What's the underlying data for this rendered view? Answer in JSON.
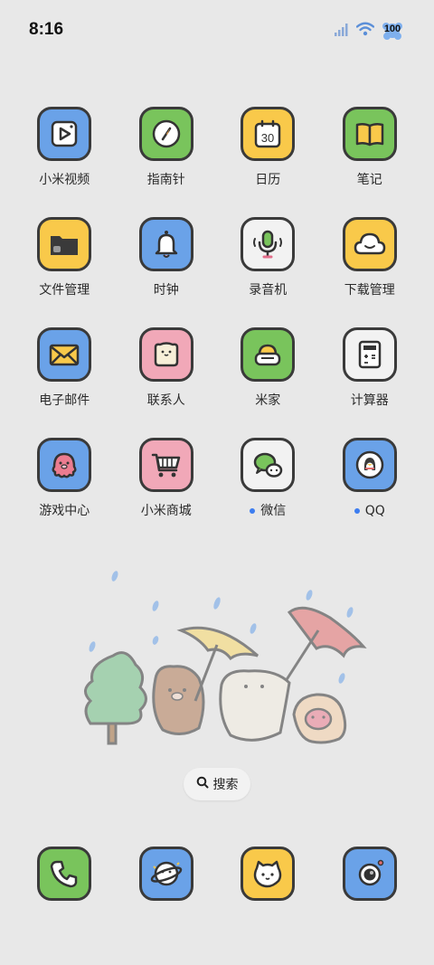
{
  "status_bar": {
    "time": "8:16",
    "battery_level": "100",
    "icons": [
      "signal-icon",
      "wifi-icon",
      "battery-icon"
    ]
  },
  "colors": {
    "background": "#e8e8e8",
    "blue": "#6aa2e8",
    "green": "#79c45c",
    "yellow": "#f9c94a",
    "pink": "#f1a8b8",
    "white": "#f2f2f2",
    "dot": "#3d7df0"
  },
  "apps": [
    {
      "label": "小米视频",
      "icon": "video-play-icon",
      "color": "blue"
    },
    {
      "label": "指南针",
      "icon": "compass-icon",
      "color": "green"
    },
    {
      "label": "日历",
      "icon": "calendar-icon",
      "color": "yellow",
      "day": "30"
    },
    {
      "label": "笔记",
      "icon": "notebook-icon",
      "color": "green"
    },
    {
      "label": "文件管理",
      "icon": "folder-icon",
      "color": "yellow"
    },
    {
      "label": "时钟",
      "icon": "bell-icon",
      "color": "blue"
    },
    {
      "label": "录音机",
      "icon": "microphone-icon",
      "color": "white"
    },
    {
      "label": "下载管理",
      "icon": "cloud-icon",
      "color": "yellow"
    },
    {
      "label": "电子邮件",
      "icon": "envelope-icon",
      "color": "blue"
    },
    {
      "label": "联系人",
      "icon": "contact-card-icon",
      "color": "pink"
    },
    {
      "label": "米家",
      "icon": "home-sofa-icon",
      "color": "green"
    },
    {
      "label": "计算器",
      "icon": "calculator-icon",
      "color": "white"
    },
    {
      "label": "游戏中心",
      "icon": "octopus-icon",
      "color": "blue"
    },
    {
      "label": "小米商城",
      "icon": "shopping-cart-icon",
      "color": "pink"
    },
    {
      "label": "微信",
      "icon": "wechat-icon",
      "color": "white",
      "new": true
    },
    {
      "label": "QQ",
      "icon": "penguin-icon",
      "color": "blue",
      "new": true
    }
  ],
  "search": {
    "label": "搜索",
    "icon": "search-icon"
  },
  "dock": [
    {
      "icon": "phone-icon",
      "color": "green"
    },
    {
      "icon": "planet-icon",
      "color": "blue"
    },
    {
      "icon": "cat-face-icon",
      "color": "yellow"
    },
    {
      "icon": "camera-icon",
      "color": "blue"
    }
  ]
}
